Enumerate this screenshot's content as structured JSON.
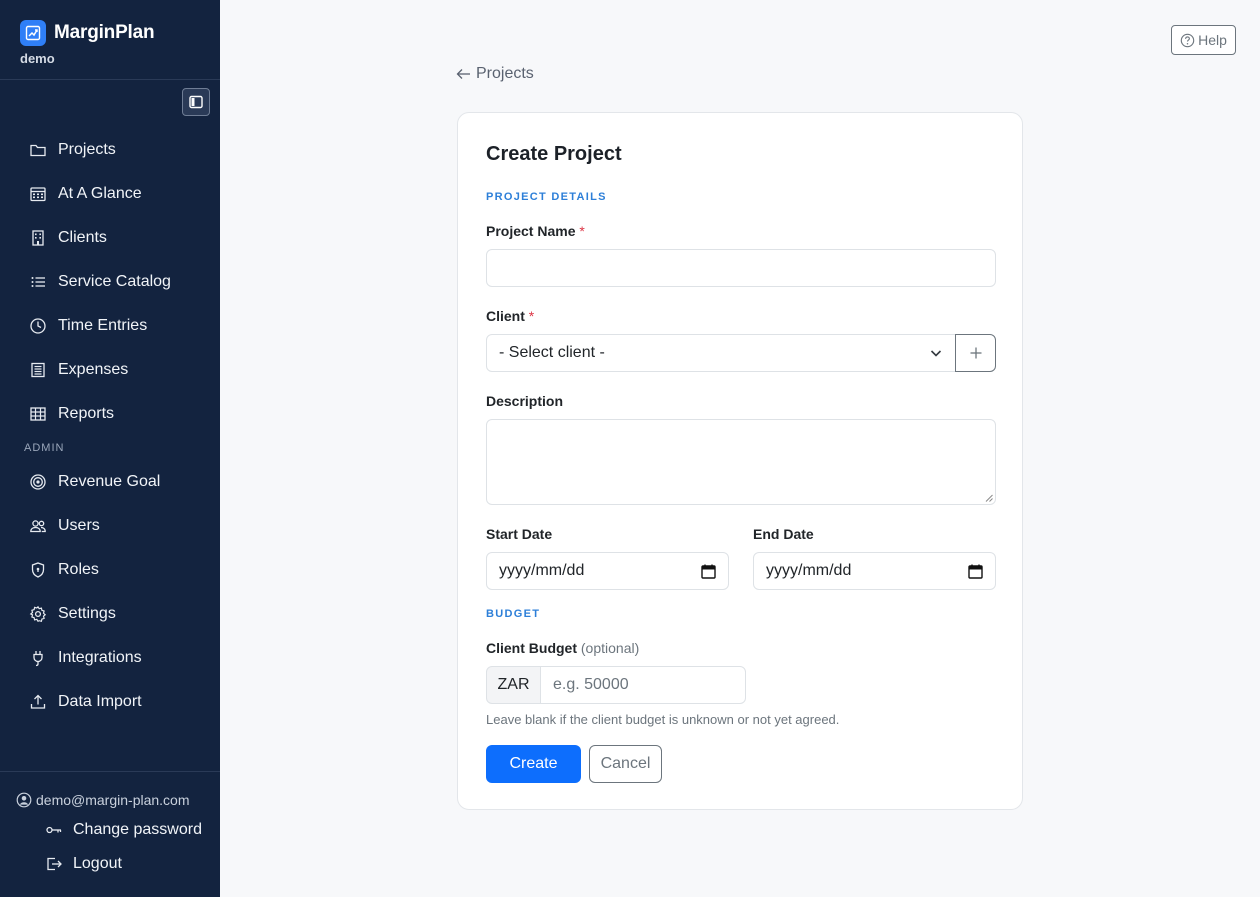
{
  "brand": {
    "name": "MarginPlan",
    "tenant": "demo"
  },
  "sidebar": {
    "items": [
      {
        "label": "Projects",
        "icon": "folder-icon"
      },
      {
        "label": "At A Glance",
        "icon": "calendar-grid-icon"
      },
      {
        "label": "Clients",
        "icon": "building-icon"
      },
      {
        "label": "Service Catalog",
        "icon": "list-icon"
      },
      {
        "label": "Time Entries",
        "icon": "clock-icon"
      },
      {
        "label": "Expenses",
        "icon": "receipt-icon"
      },
      {
        "label": "Reports",
        "icon": "table-icon"
      }
    ],
    "admin_label": "ADMIN",
    "admin_items": [
      {
        "label": "Revenue Goal",
        "icon": "target-icon"
      },
      {
        "label": "Users",
        "icon": "users-icon"
      },
      {
        "label": "Roles",
        "icon": "shield-icon"
      },
      {
        "label": "Settings",
        "icon": "gear-icon"
      },
      {
        "label": "Integrations",
        "icon": "plug-icon"
      },
      {
        "label": "Data Import",
        "icon": "upload-icon"
      }
    ],
    "user_email": "demo@margin-plan.com",
    "change_password": "Change password",
    "logout": "Logout"
  },
  "header": {
    "help_label": "Help",
    "back_label": "Projects"
  },
  "form": {
    "title": "Create Project",
    "section_details": "PROJECT DETAILS",
    "project_name_label": "Project Name",
    "project_name_value": "",
    "client_label": "Client",
    "client_selected": "- Select client -",
    "description_label": "Description",
    "start_date_label": "Start Date",
    "start_date_placeholder": "yyyy/mm/dd",
    "end_date_label": "End Date",
    "end_date_placeholder": "yyyy/mm/dd",
    "section_budget": "BUDGET",
    "client_budget_label": "Client Budget",
    "client_budget_optional": "(optional)",
    "currency": "ZAR",
    "budget_placeholder": "e.g. 50000",
    "budget_help": "Leave blank if the client budget is unknown or not yet agreed.",
    "required_marker": "*",
    "create_label": "Create",
    "cancel_label": "Cancel"
  },
  "colors": {
    "sidebar_bg": "#13233f",
    "accent": "#0d6efd",
    "section_label": "#2d7fd8",
    "required": "#dc3545"
  }
}
